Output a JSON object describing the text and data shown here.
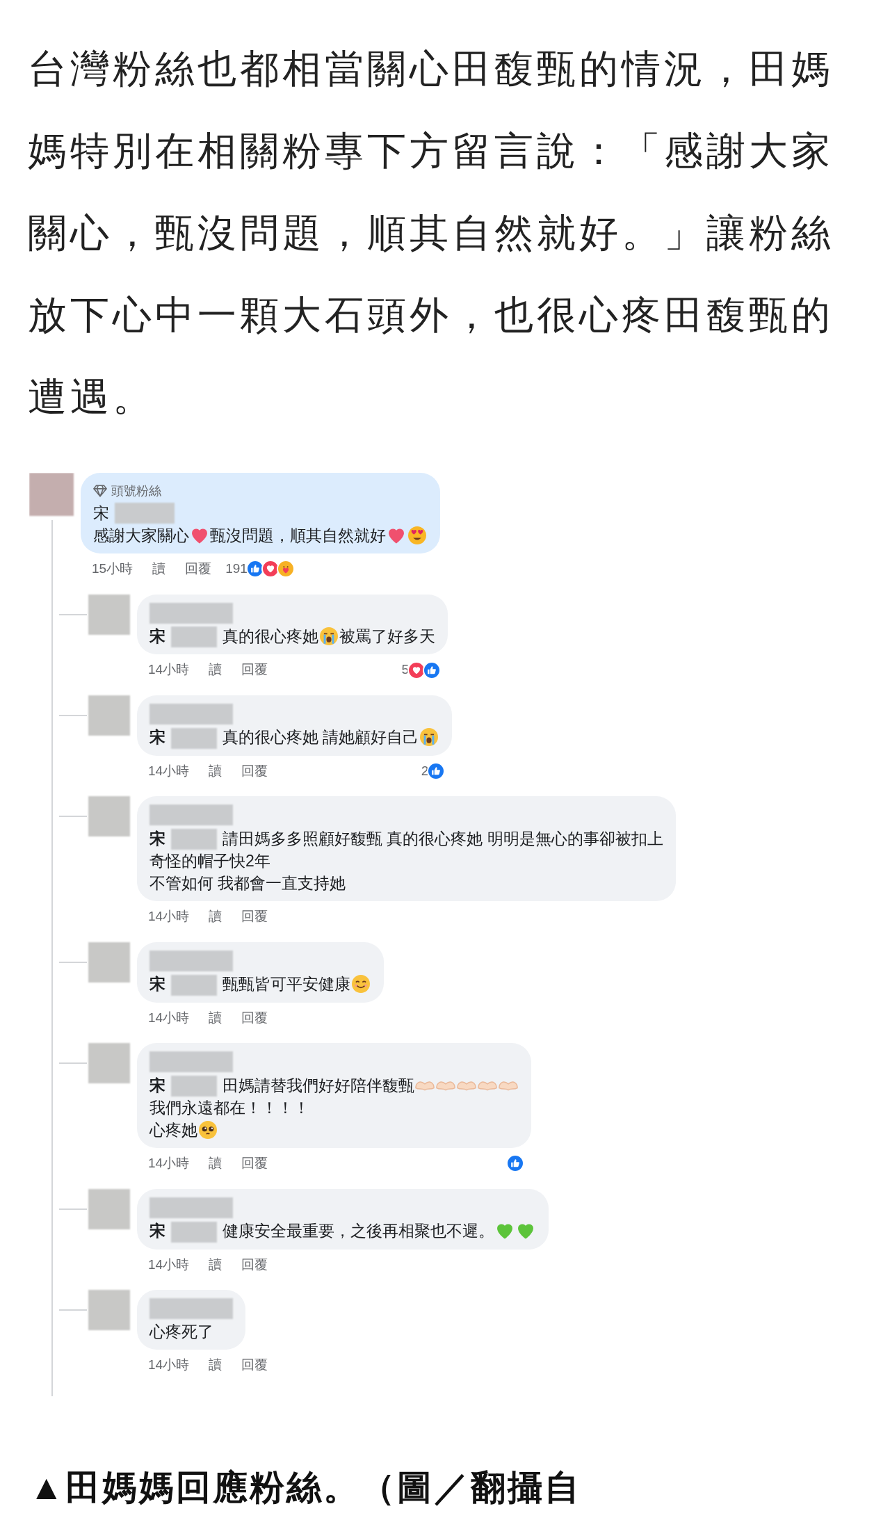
{
  "article": {
    "paragraph": "台灣粉絲也都相當關心田馥甄的情況，田媽媽特別在相關粉專下方留言說：「感謝大家關心，甄沒問題，順其自然就好。」讓粉絲放下心中一顆大石頭外，也很心疼田馥甄的遭遇。"
  },
  "screenshot": {
    "comments": [
      {
        "highlighted": true,
        "badge": "頭號粉絲",
        "name": "宋",
        "name_separate": true,
        "lines": [
          [
            {
              "kind": "text",
              "text": "感謝大家關心"
            },
            {
              "kind": "heart"
            },
            {
              "kind": "text",
              "text": "甄沒問題，順其自然就好"
            },
            {
              "kind": "heart"
            },
            {
              "kind": "heart_eyes"
            }
          ]
        ],
        "time": "15小時",
        "read": "讀",
        "reply": "回覆",
        "reactions": {
          "inline": true,
          "count": "191",
          "icons": [
            {
              "kind": "like"
            },
            {
              "kind": "love"
            },
            {
              "kind": "care"
            }
          ]
        }
      },
      {
        "highlighted": false,
        "name": "宋",
        "name_separate": false,
        "lines": [
          [
            {
              "kind": "text",
              "text": "真的很心疼她"
            },
            {
              "kind": "crying"
            },
            {
              "kind": "text",
              "text": "被罵了好多天"
            }
          ]
        ],
        "time": "14小時",
        "read": "讀",
        "reply": "回覆",
        "reactions": {
          "inline": false,
          "count": "5",
          "icons": [
            {
              "kind": "love"
            },
            {
              "kind": "like"
            }
          ]
        }
      },
      {
        "highlighted": false,
        "name": "宋",
        "name_separate": false,
        "lines": [
          [
            {
              "kind": "text",
              "text": "真的很心疼她 請她顧好自己"
            },
            {
              "kind": "crying"
            }
          ]
        ],
        "time": "14小時",
        "read": "讀",
        "reply": "回覆",
        "reactions": {
          "inline": false,
          "count": "2",
          "icons": [
            {
              "kind": "like"
            }
          ]
        }
      },
      {
        "highlighted": false,
        "name": "宋",
        "name_separate": false,
        "lines": [
          [
            {
              "kind": "text",
              "text": "請田媽多多照顧好馥甄 真的很心疼她 明明是無心的事卻被扣上"
            }
          ],
          [
            {
              "kind": "text",
              "text": "奇怪的帽子快2年"
            }
          ],
          [
            {
              "kind": "text",
              "text": "不管如何 我都會一直支持她"
            }
          ]
        ],
        "time": "14小時",
        "read": "讀",
        "reply": "回覆"
      },
      {
        "highlighted": false,
        "name": "宋",
        "name_separate": false,
        "lines": [
          [
            {
              "kind": "text",
              "text": "甄甄皆可平安健康"
            },
            {
              "kind": "smile"
            }
          ]
        ],
        "time": "14小時",
        "read": "讀",
        "reply": "回覆"
      },
      {
        "highlighted": false,
        "name": "宋",
        "name_separate": false,
        "lines": [
          [
            {
              "kind": "text",
              "text": "田媽請替我們好好陪伴馥甄"
            },
            {
              "kind": "hands"
            },
            {
              "kind": "hands"
            },
            {
              "kind": "hands"
            },
            {
              "kind": "hands"
            },
            {
              "kind": "hands"
            }
          ],
          [
            {
              "kind": "text",
              "text": "我們永遠都在！！！！"
            }
          ],
          [
            {
              "kind": "text",
              "text": "心疼她"
            },
            {
              "kind": "pleading"
            }
          ]
        ],
        "time": "14小時",
        "read": "讀",
        "reply": "回覆",
        "reactions": {
          "icons": [
            {
              "kind": "like"
            }
          ]
        }
      },
      {
        "highlighted": false,
        "name": "宋",
        "name_separate": false,
        "lines": [
          [
            {
              "kind": "text",
              "text": "健康安全最重要，之後再相聚也不遲。"
            },
            {
              "kind": "green_heart"
            },
            {
              "kind": "green_heart"
            }
          ]
        ],
        "time": "14小時",
        "read": "讀",
        "reply": "回覆"
      },
      {
        "highlighted": false,
        "lines": [
          [
            {
              "kind": "text",
              "text": "心疼死了"
            }
          ]
        ],
        "time": "14小時",
        "read": "讀",
        "reply": "回覆"
      }
    ]
  },
  "caption": "▲田媽媽回應粉絲。（圖／翻攝自"
}
